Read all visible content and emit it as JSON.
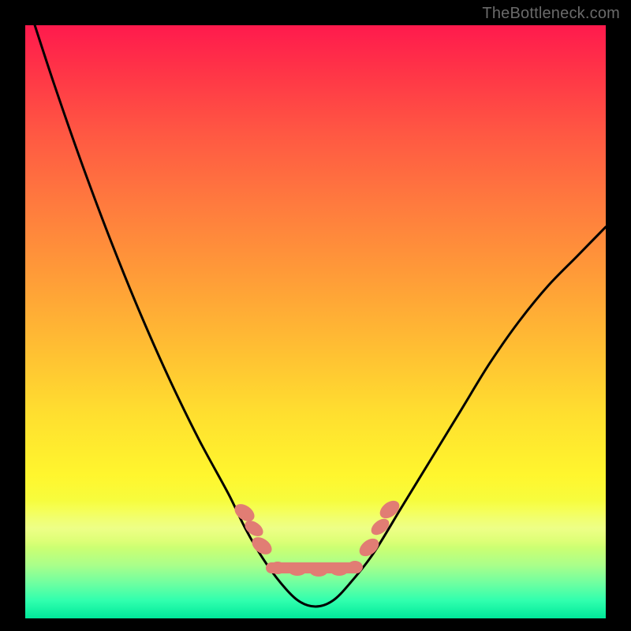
{
  "attribution": "TheBottleneck.com",
  "colors": {
    "curve_stroke": "#000000",
    "chain_color": "#e17d74",
    "frame_background": "#000000",
    "gradient_top": "#ff1a4d",
    "gradient_bottom": "#00e89a"
  },
  "chart_data": {
    "type": "line",
    "title": "",
    "xlabel": "",
    "ylabel": "",
    "xlim": [
      0,
      100
    ],
    "ylim": [
      0,
      100
    ],
    "grid": false,
    "legend": false,
    "x": [
      0,
      5,
      10,
      15,
      20,
      25,
      30,
      35,
      38,
      41,
      44,
      47,
      50,
      53,
      56,
      60,
      65,
      70,
      75,
      80,
      85,
      90,
      95,
      100
    ],
    "values": [
      105,
      90,
      76,
      63,
      51,
      40,
      30,
      21,
      15,
      10,
      6,
      3,
      2,
      3,
      6,
      11,
      19,
      27,
      35,
      43,
      50,
      56,
      61,
      66
    ],
    "annotations": [
      {
        "type": "marker-cluster",
        "shape": "oval-chain",
        "color": "#e17d74",
        "x_range": [
          36,
          60
        ],
        "y_range": [
          2,
          18
        ]
      }
    ]
  }
}
